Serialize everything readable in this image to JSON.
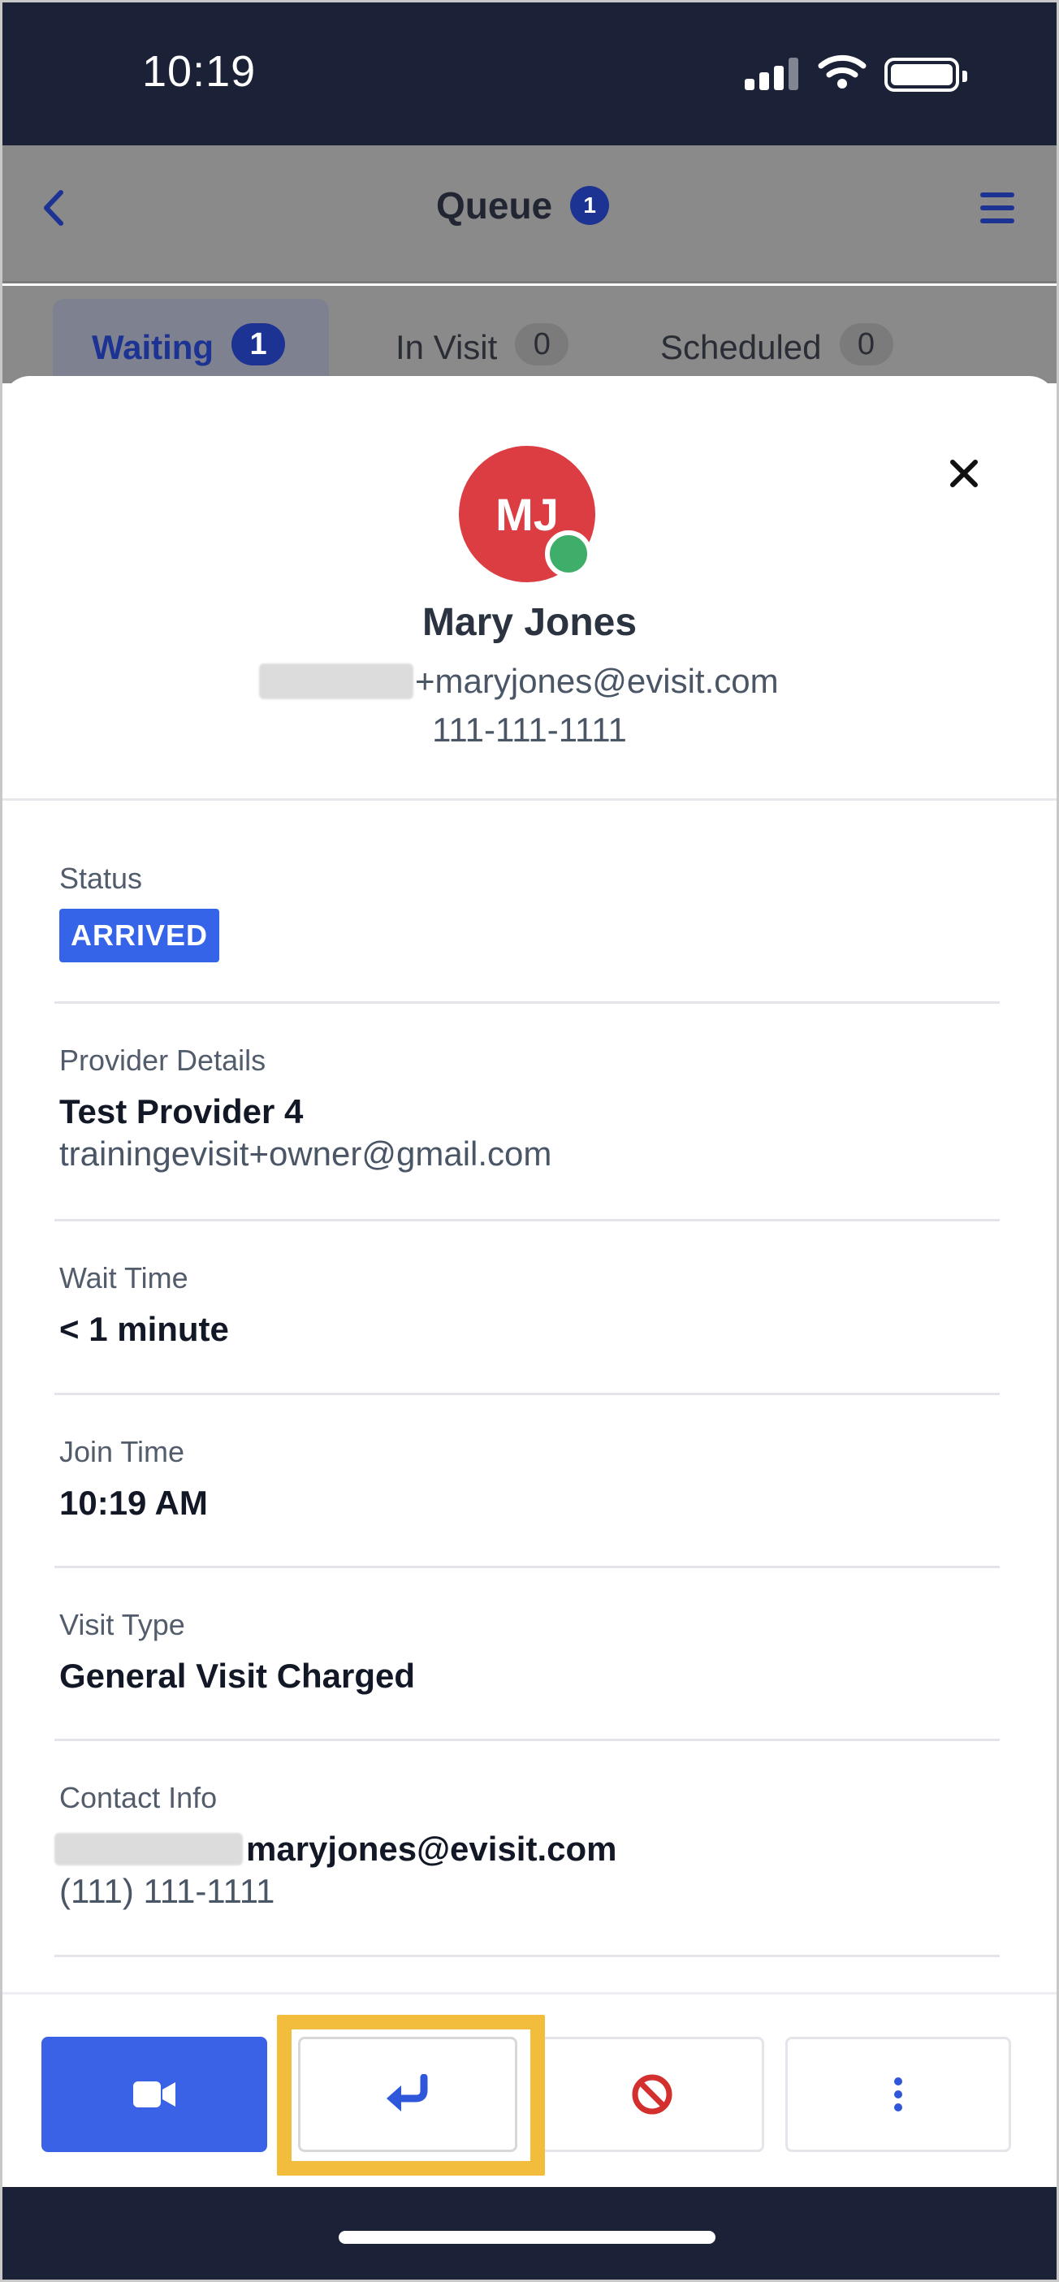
{
  "status_bar": {
    "time": "10:19"
  },
  "header": {
    "title": "Queue",
    "count": "1"
  },
  "tabs": [
    {
      "label": "Waiting",
      "count": "1"
    },
    {
      "label": "In Visit",
      "count": "0"
    },
    {
      "label": "Scheduled",
      "count": "0"
    }
  ],
  "patient": {
    "initials": "MJ",
    "name": "Mary Jones",
    "email_visible": "+maryjones@evisit.com",
    "phone": "111-111-1111"
  },
  "details": {
    "status_label": "Status",
    "status_value": "ARRIVED",
    "provider_label": "Provider Details",
    "provider_name": "Test Provider 4",
    "provider_email": "trainingevisit+owner@gmail.com",
    "wait_label": "Wait Time",
    "wait_value": "< 1 minute",
    "join_label": "Join Time",
    "join_value": "10:19 AM",
    "visit_type_label": "Visit Type",
    "visit_type_value": "General Visit Charged",
    "contact_label": "Contact Info",
    "contact_email_visible": "maryjones@evisit.com",
    "contact_phone": "(111) 111-1111"
  },
  "actions": {
    "video": "video-camera-icon",
    "return": "return-arrow-icon",
    "cancel": "block-icon",
    "more": "more-vertical-icon"
  },
  "colors": {
    "primary": "#3a62e6",
    "navy": "#1d3393",
    "status_bar": "#1b2137",
    "avatar": "#db3d43",
    "online": "#3fae6a",
    "danger": "#d32f2f",
    "highlight": "#f2bd3c"
  }
}
